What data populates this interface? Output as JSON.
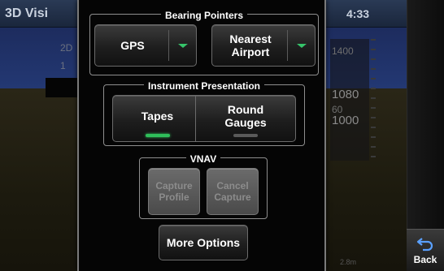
{
  "background": {
    "title": "3D Visi",
    "time": "4:33",
    "left_text_1": "2D",
    "left_text_2": "1",
    "tape_values": [
      "1400",
      "1080",
      "60",
      "1000"
    ],
    "bottom_text": "2.8m"
  },
  "bearing_pointers": {
    "title": "Bearing Pointers",
    "pointer_1": {
      "value": "GPS"
    },
    "pointer_2": {
      "value": "Nearest\nAirport"
    }
  },
  "instrument_presentation": {
    "title": "Instrument Presentation",
    "options": [
      {
        "label": "Tapes",
        "selected": true
      },
      {
        "label": "Round\nGauges",
        "selected": false
      }
    ]
  },
  "vnav": {
    "title": "VNAV",
    "capture_profile_label": "Capture\nProfile",
    "cancel_capture_label": "Cancel\nCapture"
  },
  "more_options_label": "More Options",
  "softkeys": {
    "back_label": "Back"
  },
  "colors": {
    "selected_indicator": "#2fbf5a",
    "dropdown_arrow": "#36c46a",
    "disabled_button": "#5a5a5a"
  }
}
